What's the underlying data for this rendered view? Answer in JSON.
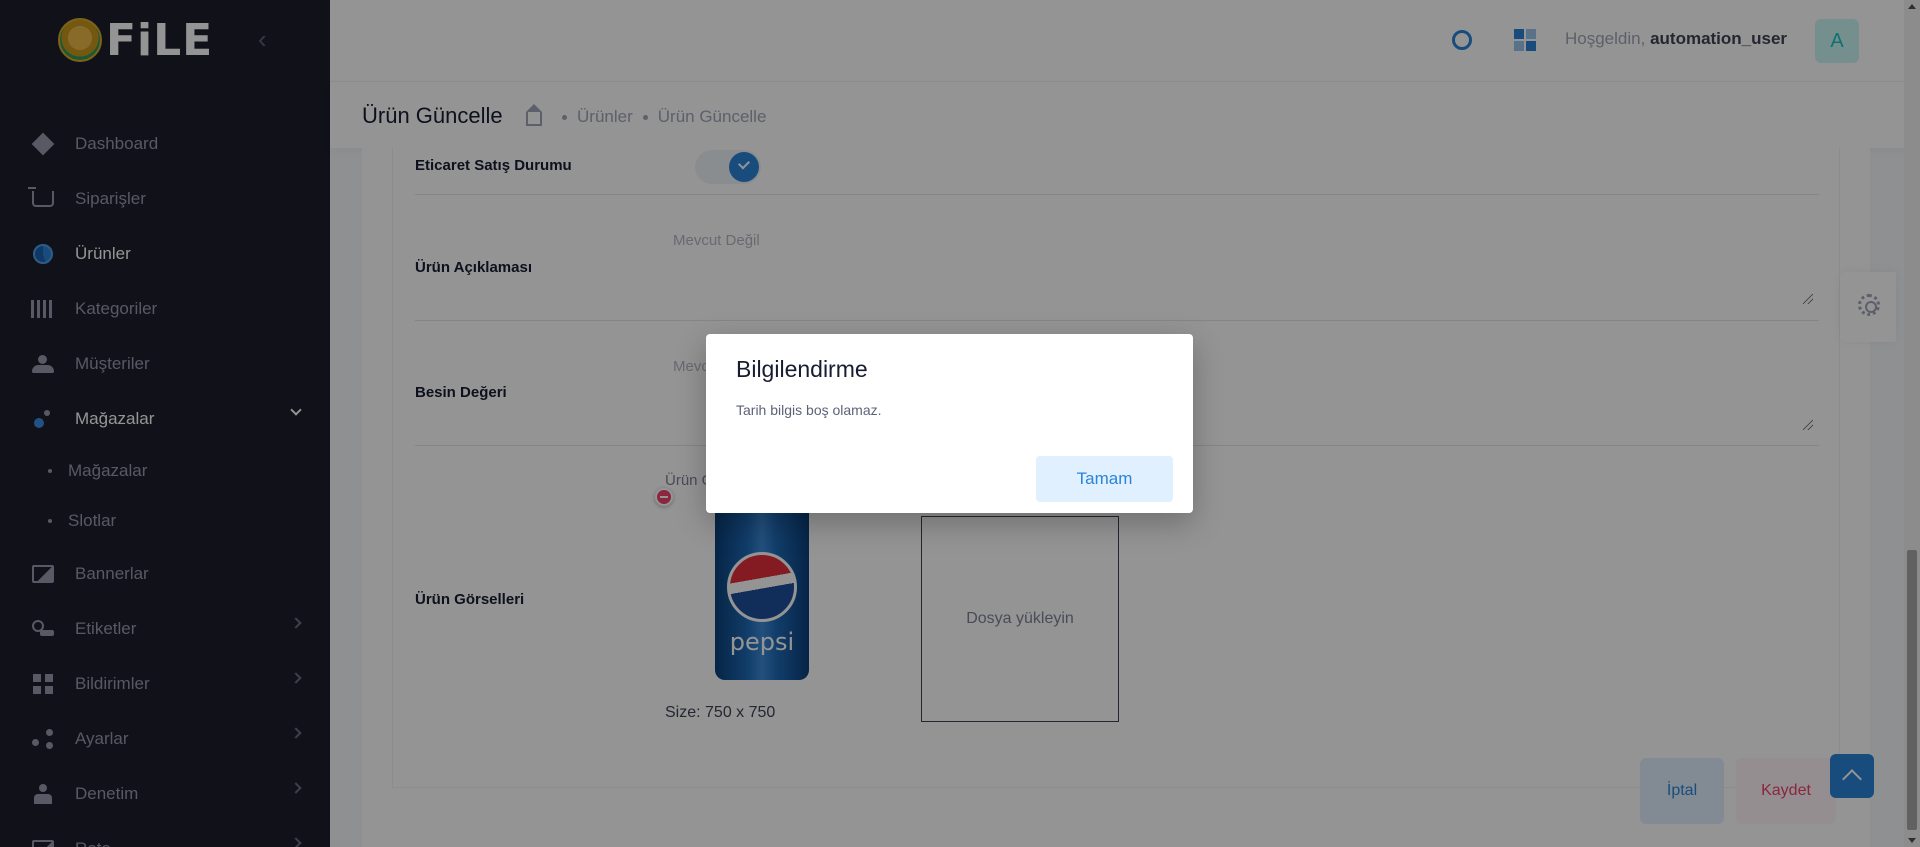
{
  "brand": {
    "logo_text": "FiLE"
  },
  "sidebar": {
    "items": [
      {
        "label": "Dashboard",
        "icon": "diamond-icon"
      },
      {
        "label": "Siparişler",
        "icon": "cart-icon"
      },
      {
        "label": "Ürünler",
        "icon": "globe-icon",
        "active": true
      },
      {
        "label": "Kategoriler",
        "icon": "barcode-icon"
      },
      {
        "label": "Müşteriler",
        "icon": "users-icon"
      },
      {
        "label": "Mağazalar",
        "icon": "store-icon",
        "expanded": true
      },
      {
        "label": "Bannerlar",
        "icon": "image-icon"
      },
      {
        "label": "Etiketler",
        "icon": "tag-icon"
      },
      {
        "label": "Bildirimler",
        "icon": "grid-icon"
      },
      {
        "label": "Ayarlar",
        "icon": "nodes-icon"
      },
      {
        "label": "Denetim",
        "icon": "person-icon"
      },
      {
        "label": "Rota",
        "icon": "route-icon"
      }
    ],
    "subitems": [
      {
        "label": "Mağazalar"
      },
      {
        "label": "Slotlar"
      }
    ]
  },
  "header": {
    "greeting_prefix": "Hoşgeldin,",
    "username": "automation_user",
    "avatar_letter": "A"
  },
  "toolbar": {
    "title": "Ürün Güncelle",
    "breadcrumb": [
      "Ürünler",
      "Ürün Güncelle"
    ]
  },
  "form": {
    "ecommerce_status_label": "Eticaret Satış Durumu",
    "ecommerce_status_on": true,
    "description_label": "Ürün Açıklaması",
    "description_value": "Mevcut Değil",
    "nutrition_label": "Besin Değeri",
    "nutrition_value": "Mevcut Değil",
    "images_label": "Ürün Görselleri",
    "image_caption": "Ürün Görseli",
    "image_brand_text": "pepsi",
    "size_text": "Size: 750 x 750",
    "upload_text": "Dosya yükleyin"
  },
  "actions": {
    "cancel_label": "İptal",
    "save_label": "Kaydet"
  },
  "modal": {
    "title": "Bilgilendirme",
    "message": "Tarih bilgis boş olamaz.",
    "ok_label": "Tamam"
  },
  "colors": {
    "primary": "#2a84d8",
    "danger": "#f1416c",
    "sidebar_bg": "#1e1e2d"
  }
}
